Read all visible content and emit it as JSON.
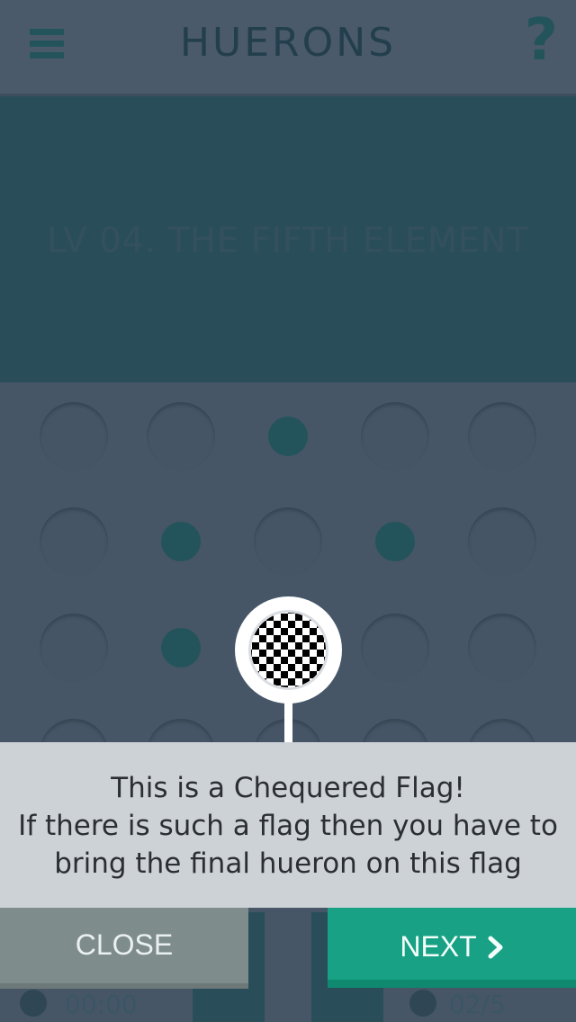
{
  "header": {
    "title": "HUERONS",
    "menu_icon": "hamburger-menu-icon",
    "help_icon": "question-mark-icon",
    "help_glyph": "?"
  },
  "level": {
    "title": "LV 04. THE FIFTH ELEMENT"
  },
  "board": {
    "rows": [
      [
        false,
        false,
        true,
        false,
        false
      ],
      [
        false,
        true,
        false,
        true,
        false
      ],
      [
        false,
        true,
        false,
        false,
        false
      ],
      [
        false,
        false,
        false,
        false,
        false
      ]
    ]
  },
  "tooltip": {
    "icon": "chequered-flag-icon",
    "lines": [
      "This is a Chequered Flag!",
      "If there is such a flag then you have to",
      "bring the final hueron on this flag"
    ]
  },
  "buttons": {
    "close_label": "CLOSE",
    "next_label": "NEXT"
  },
  "footer": {
    "left_stat": "00:00",
    "right_stat": "02/5"
  },
  "colors": {
    "background": "#465667",
    "banner": "#2a4d5a",
    "dark_teal": "#24545b",
    "next_green": "#18a184",
    "close_gray": "#7f8c8c",
    "tooltip_bg": "#cdd2d7"
  }
}
